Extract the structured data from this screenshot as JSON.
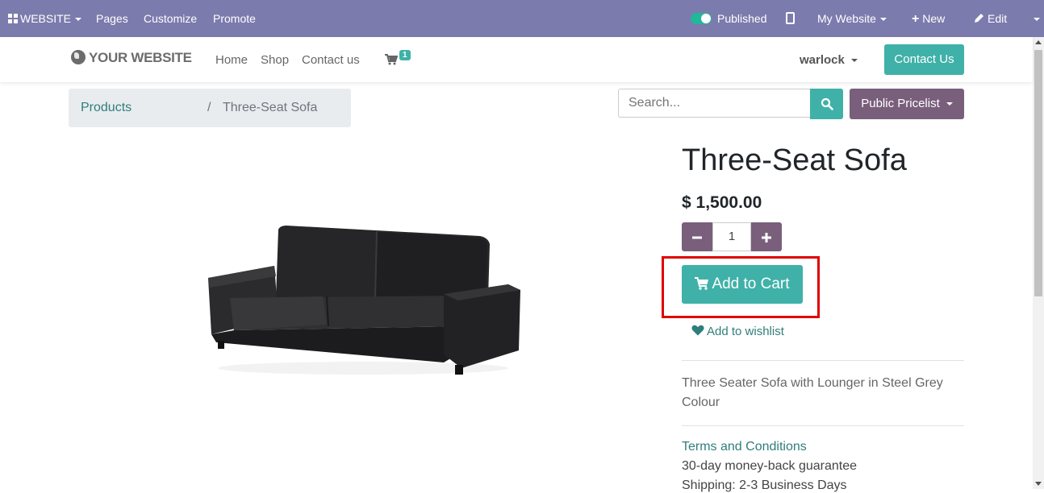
{
  "topbar": {
    "website_menu": "WEBSITE",
    "pages": "Pages",
    "customize": "Customize",
    "promote": "Promote",
    "published": "Published",
    "my_website": "My Website",
    "new": "New",
    "edit": "Edit"
  },
  "header": {
    "logo": "YOUR WEBSITE",
    "nav": [
      "Home",
      "Shop",
      "Contact us"
    ],
    "cart_count": "1",
    "user": "warlock",
    "contact_button": "Contact Us"
  },
  "breadcrumb": {
    "parent": "Products",
    "separator": "/",
    "current": "Three-Seat Sofa"
  },
  "search": {
    "placeholder": "Search..."
  },
  "pricelist": "Public Pricelist",
  "product": {
    "name": "Three-Seat Sofa",
    "price": "$ 1,500.00",
    "quantity": "1",
    "add_to_cart": "Add to Cart",
    "wishlist": "Add to wishlist",
    "description": "Three Seater Sofa with Lounger in Steel Grey Colour",
    "terms": "Terms and Conditions",
    "guarantee": "30-day money-back guarantee",
    "shipping": "Shipping: 2-3 Business Days"
  },
  "colors": {
    "topbar": "#7c7bad",
    "accent": "#3fb1a8",
    "secondary": "#795f7c",
    "highlight": "#e00000"
  }
}
